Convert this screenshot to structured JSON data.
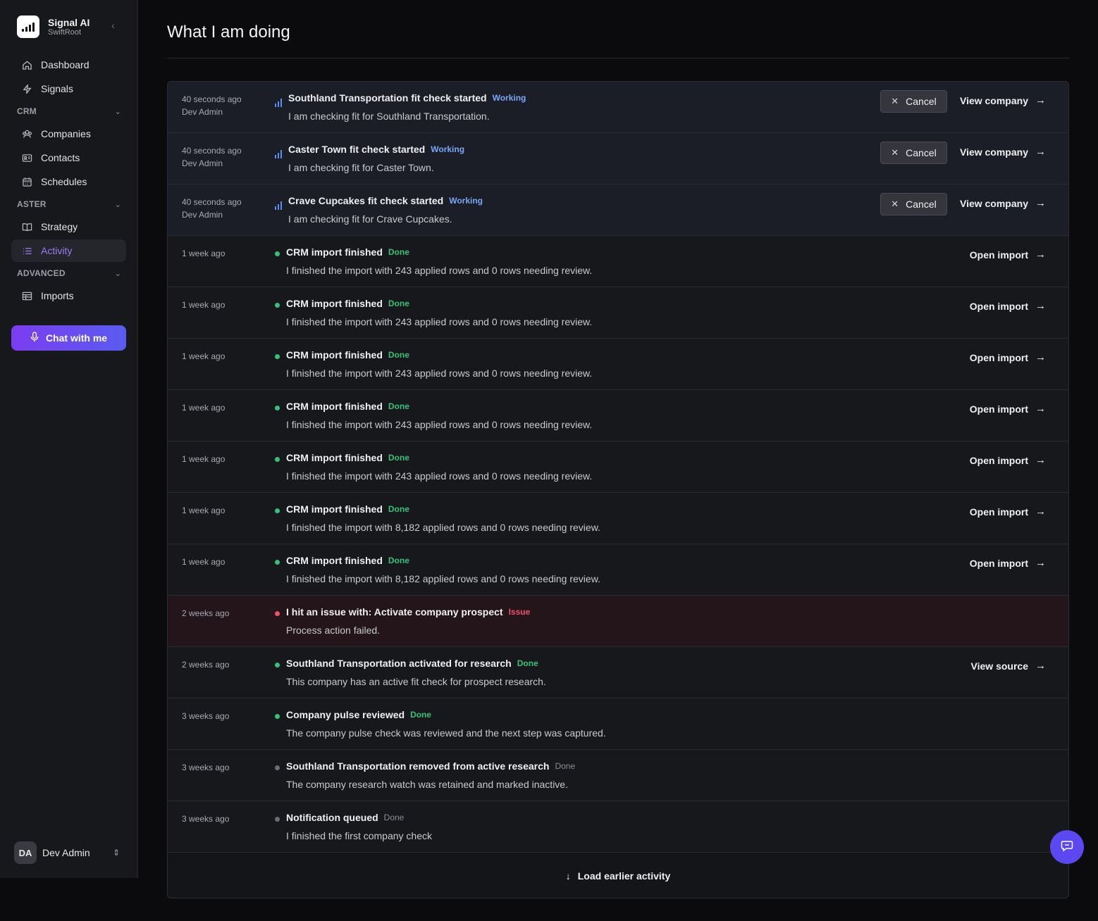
{
  "app": {
    "name": "Signal AI",
    "org": "SwiftRoot"
  },
  "sidebar": {
    "primary": [
      {
        "label": "Dashboard",
        "icon": "home-icon"
      },
      {
        "label": "Signals",
        "icon": "lightning-icon"
      }
    ],
    "sections": [
      {
        "label": "CRM",
        "items": [
          {
            "label": "Companies",
            "icon": "building-icon"
          },
          {
            "label": "Contacts",
            "icon": "contact-card-icon"
          },
          {
            "label": "Schedules",
            "icon": "calendar-icon"
          }
        ]
      },
      {
        "label": "ASTER",
        "items": [
          {
            "label": "Strategy",
            "icon": "book-icon"
          },
          {
            "label": "Activity",
            "icon": "list-icon",
            "active": true
          }
        ]
      },
      {
        "label": "ADVANCED",
        "items": [
          {
            "label": "Imports",
            "icon": "table-icon"
          }
        ]
      }
    ],
    "chat_button": "Chat with me",
    "user": {
      "initials": "DA",
      "name": "Dev Admin"
    }
  },
  "main": {
    "title": "What I am doing",
    "rows": [
      {
        "when": "40 seconds ago",
        "who": "Dev Admin",
        "status": "working",
        "title": "Southland Transportation fit check started",
        "badge": "Working",
        "desc": "I am checking fit for Southland Transportation.",
        "cancel": "Cancel",
        "link": "View company"
      },
      {
        "when": "40 seconds ago",
        "who": "Dev Admin",
        "status": "working",
        "title": "Caster Town fit check started",
        "badge": "Working",
        "desc": "I am checking fit for Caster Town.",
        "cancel": "Cancel",
        "link": "View company"
      },
      {
        "when": "40 seconds ago",
        "who": "Dev Admin",
        "status": "working",
        "title": "Crave Cupcakes fit check started",
        "badge": "Working",
        "desc": "I am checking fit for Crave Cupcakes.",
        "cancel": "Cancel",
        "link": "View company"
      },
      {
        "when": "1 week ago",
        "status": "done",
        "title": "CRM import finished",
        "badge": "Done",
        "desc": "I finished the import with 243 applied rows and 0 rows needing review.",
        "link": "Open import"
      },
      {
        "when": "1 week ago",
        "status": "done",
        "title": "CRM import finished",
        "badge": "Done",
        "desc": "I finished the import with 243 applied rows and 0 rows needing review.",
        "link": "Open import"
      },
      {
        "when": "1 week ago",
        "status": "done",
        "title": "CRM import finished",
        "badge": "Done",
        "desc": "I finished the import with 243 applied rows and 0 rows needing review.",
        "link": "Open import"
      },
      {
        "when": "1 week ago",
        "status": "done",
        "title": "CRM import finished",
        "badge": "Done",
        "desc": "I finished the import with 243 applied rows and 0 rows needing review.",
        "link": "Open import"
      },
      {
        "when": "1 week ago",
        "status": "done",
        "title": "CRM import finished",
        "badge": "Done",
        "desc": "I finished the import with 243 applied rows and 0 rows needing review.",
        "link": "Open import"
      },
      {
        "when": "1 week ago",
        "status": "done",
        "title": "CRM import finished",
        "badge": "Done",
        "desc": "I finished the import with 8,182 applied rows and 0 rows needing review.",
        "link": "Open import"
      },
      {
        "when": "1 week ago",
        "status": "done",
        "title": "CRM import finished",
        "badge": "Done",
        "desc": "I finished the import with 8,182 applied rows and 0 rows needing review.",
        "link": "Open import"
      },
      {
        "when": "2 weeks ago",
        "status": "issue",
        "title": "I hit an issue with: Activate company prospect",
        "badge": "Issue",
        "desc": "Process action failed."
      },
      {
        "when": "2 weeks ago",
        "status": "done",
        "title": "Southland Transportation activated for research",
        "badge": "Done",
        "desc": "This company has an active fit check for prospect research.",
        "link": "View source"
      },
      {
        "when": "3 weeks ago",
        "status": "done",
        "title": "Company pulse reviewed",
        "badge": "Done",
        "desc": "The company pulse check was reviewed and the next step was captured."
      },
      {
        "when": "3 weeks ago",
        "status": "muted",
        "title": "Southland Transportation removed from active research",
        "badge": "Done",
        "desc": "The company research watch was retained and marked inactive."
      },
      {
        "when": "3 weeks ago",
        "status": "muted",
        "title": "Notification queued",
        "badge": "Done",
        "desc": "I finished the first company check"
      }
    ],
    "load_more": "Load earlier activity"
  },
  "colors": {
    "accent": "#9b7cf6",
    "done": "#34c27a",
    "working": "#7aa7f5",
    "issue": "#f0506e"
  }
}
